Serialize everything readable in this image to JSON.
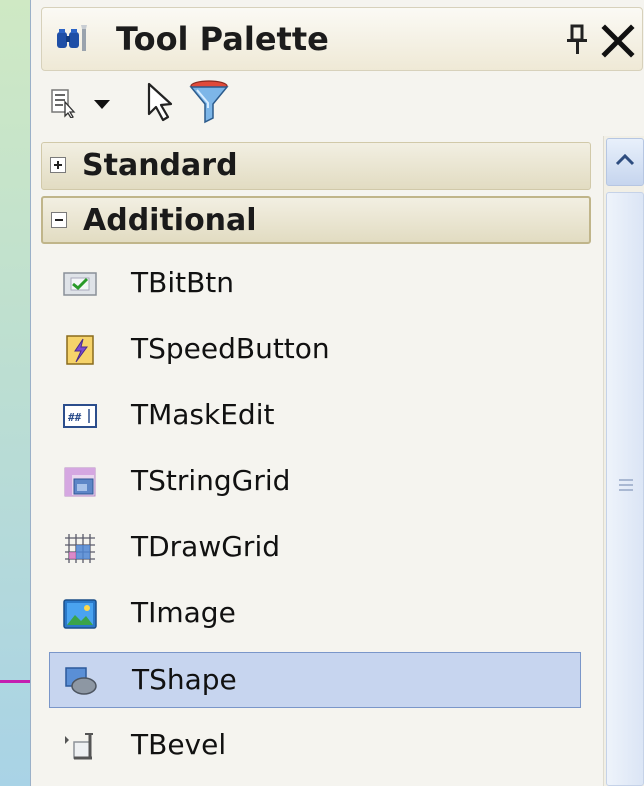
{
  "panel": {
    "title": "Tool Palette",
    "pin_glyph": "ձ"
  },
  "toolbar": {
    "items": [
      "categories-icon",
      "dropdown-arrow-icon",
      "pointer-arrow-icon",
      "filter-icon"
    ]
  },
  "categories": [
    {
      "label": "Standard",
      "expanded": false
    },
    {
      "label": "Additional",
      "expanded": true
    }
  ],
  "components": [
    {
      "label": "TBitBtn",
      "icon": "bitbtn-icon"
    },
    {
      "label": "TSpeedButton",
      "icon": "speedbutton-icon"
    },
    {
      "label": "TMaskEdit",
      "icon": "maskedit-icon"
    },
    {
      "label": "TStringGrid",
      "icon": "stringgrid-icon"
    },
    {
      "label": "TDrawGrid",
      "icon": "drawgrid-icon"
    },
    {
      "label": "TImage",
      "icon": "image-icon"
    },
    {
      "label": "TShape",
      "icon": "shape-icon",
      "selected": true
    },
    {
      "label": "TBevel",
      "icon": "bevel-icon"
    }
  ],
  "colors": {
    "selection": "#c7d5ef",
    "pointer_line": "#c41fb0",
    "background_gradient": [
      "#cfe9c4",
      "#a9d3e6"
    ]
  }
}
